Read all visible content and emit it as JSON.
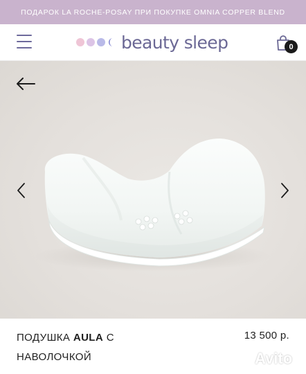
{
  "promo": {
    "text": "ПОДАРОК LA ROCHE-POSAY ПРИ ПОКУПКЕ OMNIA COPPER BLEND"
  },
  "header": {
    "logo_text": "beauty sleep",
    "logo_dot_colors": [
      "#eec6d6",
      "#d9c3e6",
      "#b7b8e6"
    ],
    "cart_count": "0",
    "accent_color": "#6b6895"
  },
  "gallery": {
    "back_icon": "arrow-left-icon",
    "prev_icon": "chevron-left-icon",
    "next_icon": "chevron-right-icon",
    "image_subject": "white anatomical pillow"
  },
  "product": {
    "title_prefix": "ПОДУШКА",
    "title_brand": "AULA",
    "title_suffix": "С НАВОЛОЧКОЙ",
    "price": "13 500 р."
  },
  "watermark": {
    "text": "Avito"
  }
}
